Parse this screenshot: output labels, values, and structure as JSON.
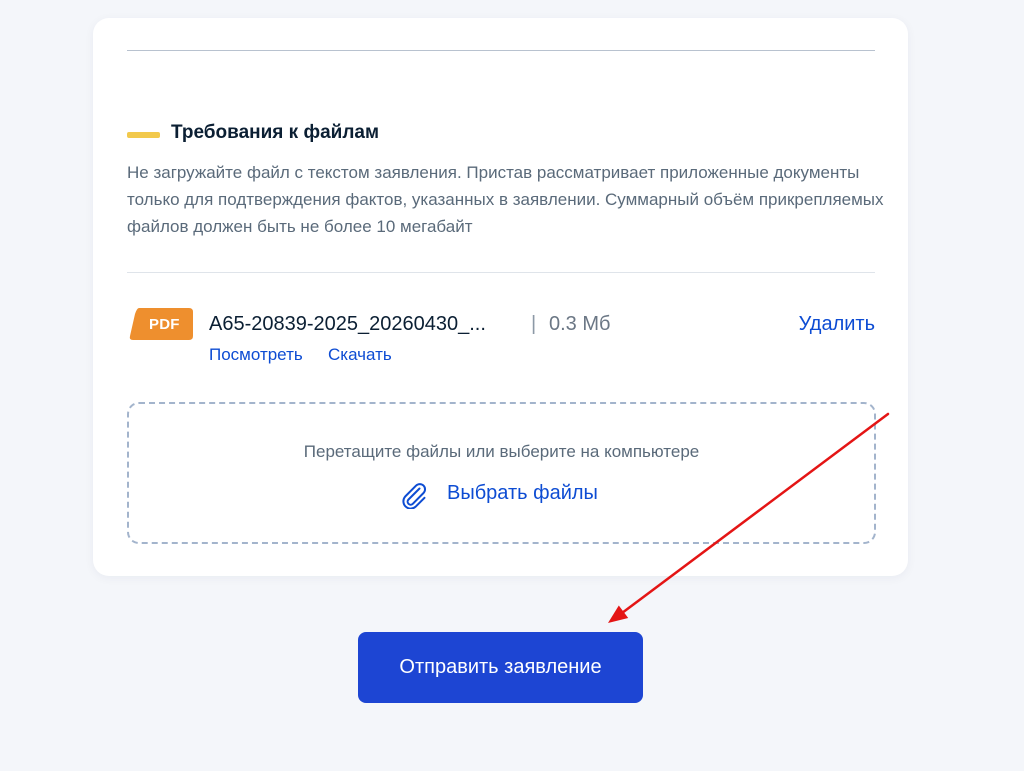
{
  "requirements": {
    "title": "Требования к файлам",
    "text": "Не загружайте файл с текстом заявления. Пристав рассматривает приложенные документы только для подтверждения фактов, указанных в заявлении. Суммарный объём прикрепляемых файлов должен быть не более 10 мегабайт",
    "marker_color": "#f2c94c"
  },
  "file": {
    "badge": "PDF",
    "badge_color": "#ee8f2e",
    "name": "A65-20839-2025_20260430_...",
    "separator": "|",
    "size": "0.3 Мб",
    "delete_label": "Удалить",
    "view_label": "Посмотреть",
    "download_label": "Скачать",
    "icon": "pdf-file-icon"
  },
  "dropzone": {
    "hint": "Перетащите файлы или выберите на компьютере",
    "choose_label": "Выбрать файлы",
    "icon": "paperclip-icon"
  },
  "submit": {
    "label": "Отправить заявление",
    "color": "#1d45d3"
  },
  "annotation": {
    "type": "arrow",
    "color": "#e41515"
  },
  "colors": {
    "link": "#0d4cd3",
    "page_background": "#f4f6fa",
    "card_background": "#ffffff"
  }
}
